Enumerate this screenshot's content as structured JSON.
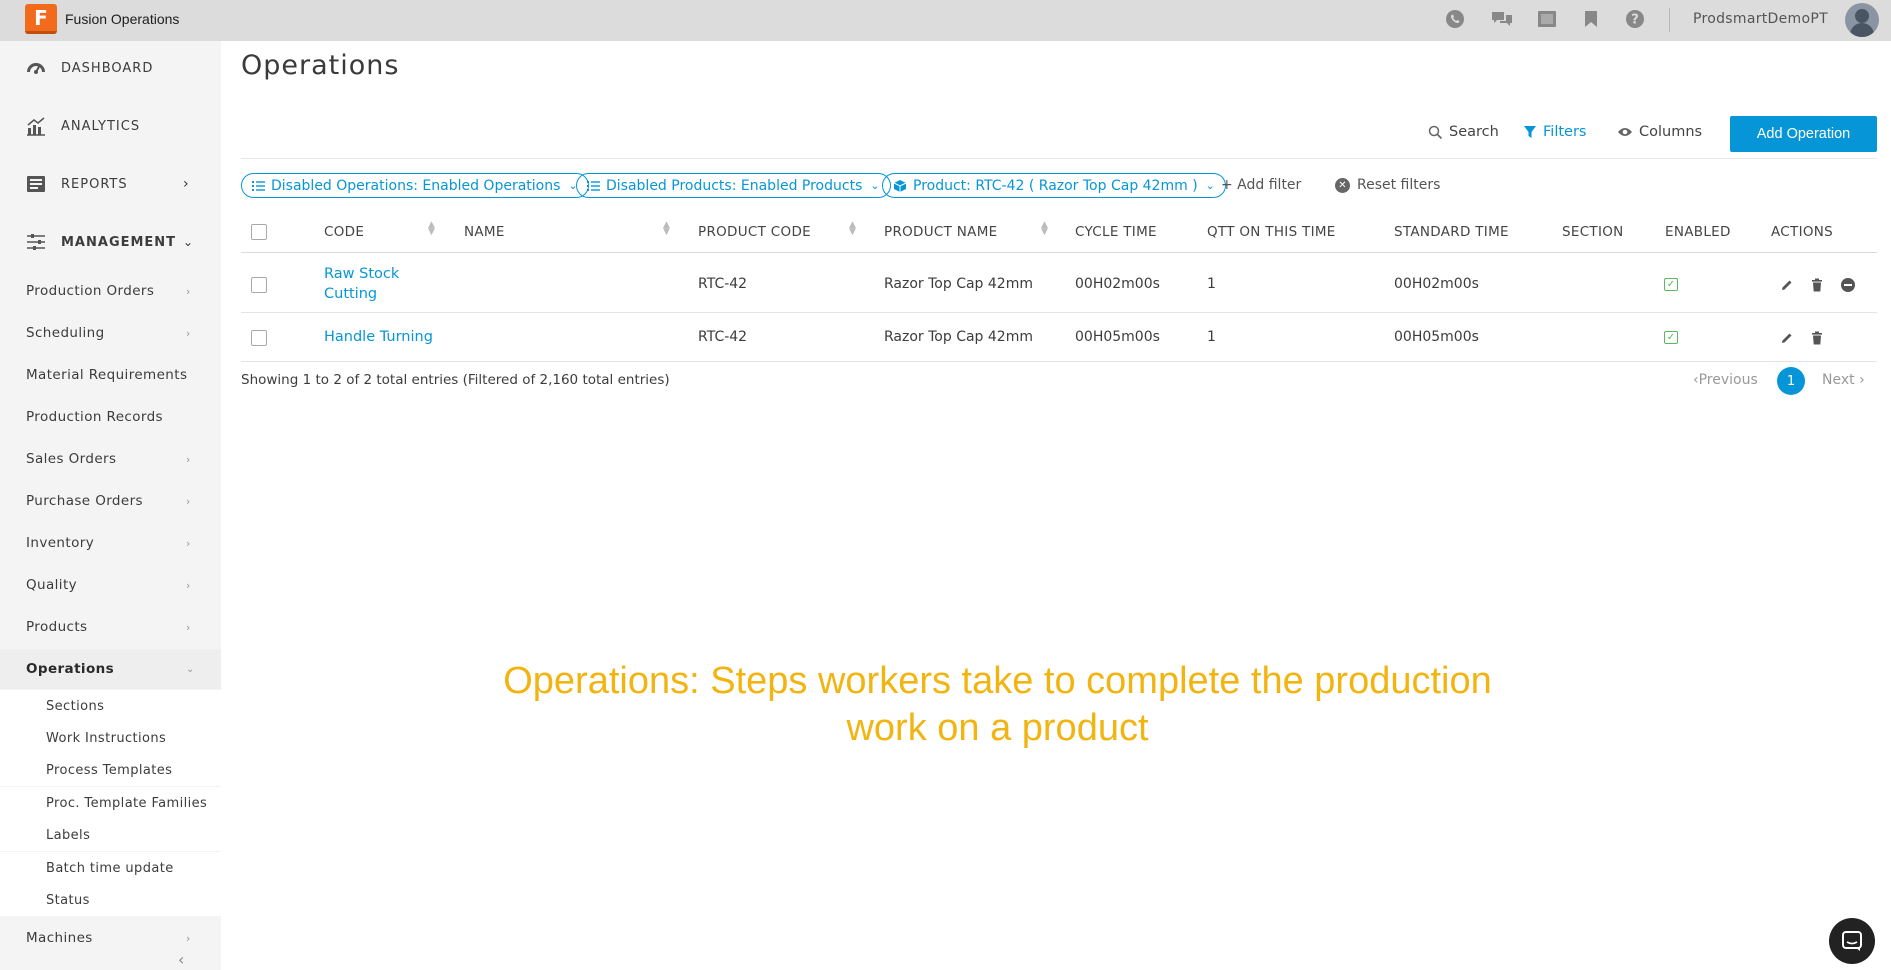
{
  "app": {
    "name": "Fusion Operations",
    "logo_letter": "F"
  },
  "topbar": {
    "icons": [
      "phone-icon",
      "chat-icon",
      "film-icon",
      "bookmark-icon",
      "help-icon"
    ],
    "username": "ProdsmartDemoPT"
  },
  "sidebar": {
    "sections": [
      {
        "label": "DASHBOARD",
        "icon": "dashboard-icon"
      },
      {
        "label": "ANALYTICS",
        "icon": "analytics-icon"
      },
      {
        "label": "REPORTS",
        "icon": "reports-icon"
      },
      {
        "label": "MANAGEMENT",
        "icon": "management-icon"
      }
    ],
    "items": [
      {
        "label": "Production Orders"
      },
      {
        "label": "Scheduling"
      },
      {
        "label": "Material Requirements"
      },
      {
        "label": "Production Records"
      },
      {
        "label": "Sales Orders"
      },
      {
        "label": "Purchase Orders"
      },
      {
        "label": "Inventory"
      },
      {
        "label": "Quality"
      },
      {
        "label": "Products"
      },
      {
        "label": "Operations"
      },
      {
        "label": "Machines"
      }
    ],
    "operations_subitems": [
      "Sections",
      "Work Instructions",
      "Process Templates",
      "Proc. Template Families",
      "Labels",
      "Batch time update",
      "Status"
    ]
  },
  "page": {
    "title": "Operations"
  },
  "toolbar": {
    "search_label": "Search",
    "filters_label": "Filters",
    "columns_label": "Columns",
    "add_button_label": "Add Operation"
  },
  "filters": {
    "chips": [
      "Disabled Operations: Enabled Operations",
      "Disabled Products: Enabled Products",
      "Product: RTC-42 ( Razor Top Cap 42mm )"
    ],
    "add_filter_label": "+ Add filter",
    "reset_label": "Reset filters"
  },
  "table": {
    "columns": [
      "CODE",
      "NAME",
      "PRODUCT CODE",
      "PRODUCT NAME",
      "CYCLE TIME",
      "QTT ON THIS TIME",
      "STANDARD TIME",
      "SECTION",
      "ENABLED",
      "ACTIONS"
    ],
    "rows": [
      {
        "code_line1": "Raw Stock",
        "code_line2": "Cutting",
        "name": "",
        "product_code": "RTC-42",
        "product_name": "Razor Top Cap 42mm",
        "cycle_time": "00H02m00s",
        "qtt": "1",
        "standard_time": "00H02m00s",
        "section": "",
        "enabled": true,
        "actions": [
          "edit-icon",
          "delete-icon",
          "disable-icon"
        ]
      },
      {
        "code_line1": "Handle Turning",
        "code_line2": "",
        "name": "",
        "product_code": "RTC-42",
        "product_name": "Razor Top Cap 42mm",
        "cycle_time": "00H05m00s",
        "qtt": "1",
        "standard_time": "00H05m00s",
        "section": "",
        "enabled": true,
        "actions": [
          "edit-icon",
          "delete-icon"
        ]
      }
    ],
    "summary": "Showing 1 to 2 of 2 total entries (Filtered of 2,160 total entries)"
  },
  "pagination": {
    "prev_label": "Previous",
    "current": "1",
    "next_label": "Next"
  },
  "caption": {
    "line1": "Operations: Steps workers take to complete the production",
    "line2": "work on a product"
  },
  "colors": {
    "accent": "#0696d7",
    "brand": "#f26b1d",
    "caption": "#f2b411",
    "enabled": "#5cb85c"
  }
}
